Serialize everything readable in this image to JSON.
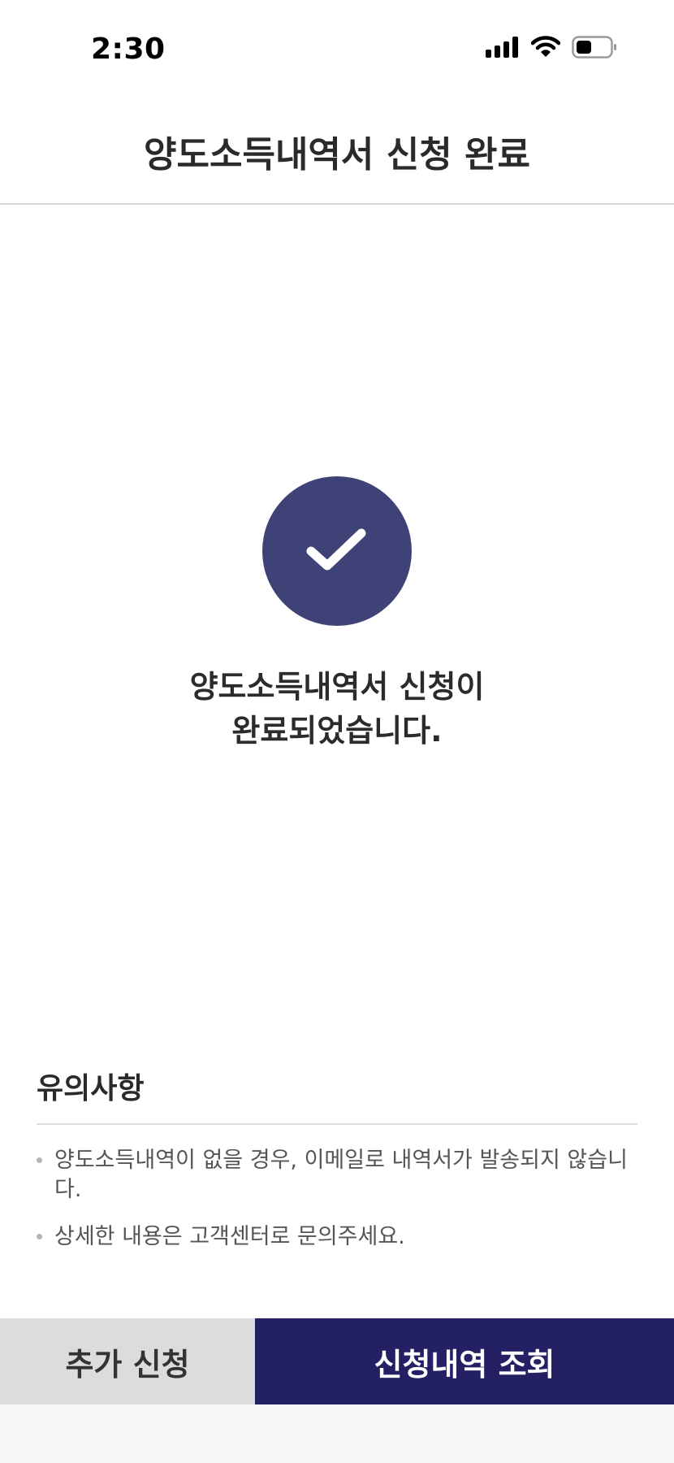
{
  "status_bar": {
    "time": "2:30",
    "icons": [
      "signal-icon",
      "wifi-icon",
      "battery-icon"
    ]
  },
  "header": {
    "title": "양도소득내역서 신청 완료"
  },
  "success": {
    "icon": "check-icon",
    "line1": "양도소득내역서 신청이",
    "line2": "완료되었습니다."
  },
  "notice": {
    "title": "유의사항",
    "items": [
      "양도소득내역이 없을 경우, 이메일로 내역서가 발송되지 않습니다.",
      "상세한 내용은 고객센터로 문의주세요."
    ]
  },
  "buttons": {
    "secondary": "추가 신청",
    "primary": "신청내역 조회"
  },
  "colors": {
    "accent": "#232163",
    "check_circle": "#3f4276"
  }
}
